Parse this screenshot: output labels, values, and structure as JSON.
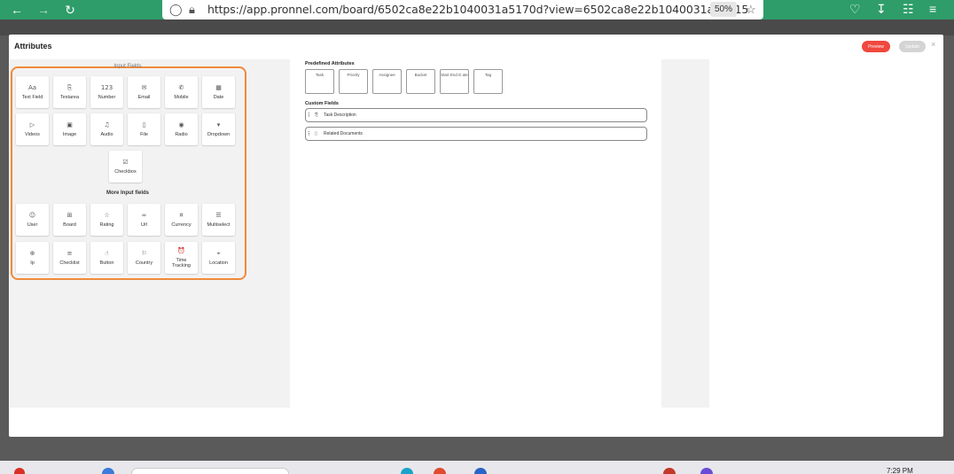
{
  "browser": {
    "url": "https://app.pronnel.com/board/6502ca8e22b1040031a5170d?view=6502ca8e22b1040031a51715",
    "zoom": "50%"
  },
  "modal": {
    "title": "Attributes",
    "preview_label": "Preview",
    "update_label": "Update",
    "close_label": "×"
  },
  "left": {
    "input_fields_label": "Input Fields",
    "input_fields": [
      {
        "label": "Text Field",
        "icon": "Aa"
      },
      {
        "label": "Textarea",
        "icon": "⎘"
      },
      {
        "label": "Number",
        "icon": "123"
      },
      {
        "label": "Email",
        "icon": "✉"
      },
      {
        "label": "Mobile",
        "icon": "✆"
      },
      {
        "label": "Date",
        "icon": "▦"
      },
      {
        "label": "Videos",
        "icon": "▷"
      },
      {
        "label": "Image",
        "icon": "▣"
      },
      {
        "label": "Audio",
        "icon": "♫"
      },
      {
        "label": "File",
        "icon": "▯"
      },
      {
        "label": "Radio",
        "icon": "◉"
      },
      {
        "label": "Dropdown",
        "icon": "▾"
      },
      {
        "label": "Checkbox",
        "icon": "☑"
      }
    ],
    "more_label": "More Input fields",
    "more_fields": [
      {
        "label": "User",
        "icon": "☺"
      },
      {
        "label": "Board",
        "icon": "⊞"
      },
      {
        "label": "Rating",
        "icon": "☆"
      },
      {
        "label": "Url",
        "icon": "∞"
      },
      {
        "label": "Currency",
        "icon": "¤"
      },
      {
        "label": "Multiselect",
        "icon": "☰"
      },
      {
        "label": "Ip",
        "icon": "⊕"
      },
      {
        "label": "Checklist",
        "icon": "≡"
      },
      {
        "label": "Button",
        "icon": "☝"
      },
      {
        "label": "Country",
        "icon": "⚐"
      },
      {
        "label": "Time\nTracking",
        "icon": "⏰"
      },
      {
        "label": "Location",
        "icon": "⌖"
      }
    ]
  },
  "center": {
    "predefined_label": "Predefined Attributes",
    "predefined": [
      "Task",
      "Priority",
      "Assignee",
      "Bucket",
      "Start End D ate",
      "Tag"
    ],
    "custom_label": "Custom Fields",
    "custom": [
      {
        "label": "Task Description",
        "icon": "⎘"
      },
      {
        "label": "Related Documents",
        "icon": "▯"
      }
    ]
  },
  "taskbar": {
    "time": "7:29 PM"
  }
}
